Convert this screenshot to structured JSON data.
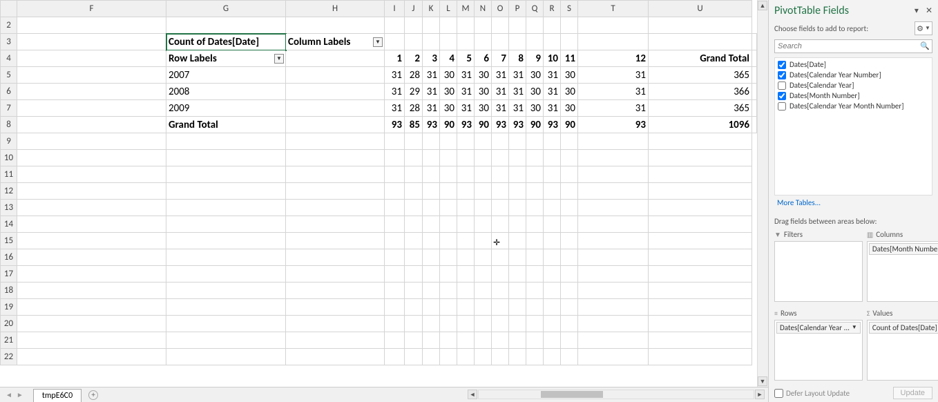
{
  "columns": [
    "F",
    "G",
    "H",
    "I",
    "J",
    "K",
    "L",
    "M",
    "N",
    "O",
    "P",
    "Q",
    "R",
    "S",
    "T",
    "U"
  ],
  "rows": [
    2,
    3,
    4,
    5,
    6,
    7,
    8,
    9,
    10,
    11,
    12,
    13,
    14,
    15,
    16,
    17,
    18,
    19,
    20,
    21,
    22
  ],
  "active_cell": "G3",
  "pivot": {
    "measure_label": "Count of Dates[Date]",
    "column_labels_label": "Column Labels",
    "row_labels_label": "Row Labels",
    "col_headers": [
      "1",
      "2",
      "3",
      "4",
      "5",
      "6",
      "7",
      "8",
      "9",
      "10",
      "11",
      "12"
    ],
    "grand_total_label": "Grand Total",
    "row_labels": [
      "2007",
      "2008",
      "2009"
    ],
    "data": [
      [
        "31",
        "28",
        "31",
        "30",
        "31",
        "30",
        "31",
        "31",
        "30",
        "31",
        "30",
        "31"
      ],
      [
        "31",
        "29",
        "31",
        "30",
        "31",
        "30",
        "31",
        "31",
        "30",
        "31",
        "30",
        "31"
      ],
      [
        "31",
        "28",
        "31",
        "30",
        "31",
        "30",
        "31",
        "31",
        "30",
        "31",
        "30",
        "31"
      ]
    ],
    "row_totals": [
      "365",
      "366",
      "365"
    ],
    "col_totals": [
      "93",
      "85",
      "93",
      "90",
      "93",
      "90",
      "93",
      "93",
      "90",
      "93",
      "90",
      "93"
    ],
    "grand_total_value": "1096"
  },
  "tabs": {
    "active": "tmpE6C0"
  },
  "pane": {
    "title": "PivotTable Fields",
    "subtitle": "Choose fields to add to report:",
    "search_placeholder": "Search",
    "fields": [
      {
        "label": "Dates[Date]",
        "checked": true
      },
      {
        "label": "Dates[Calendar Year Number]",
        "checked": true
      },
      {
        "label": "Dates[Calendar Year]",
        "checked": false
      },
      {
        "label": "Dates[Month Number]",
        "checked": true
      },
      {
        "label": "Dates[Calendar Year Month Number]",
        "checked": false
      }
    ],
    "more_tables": "More Tables...",
    "drag_hint": "Drag fields between areas below:",
    "areas": {
      "filters": {
        "label": "Filters",
        "items": []
      },
      "columns": {
        "label": "Columns",
        "items": [
          "Dates[Month Number]"
        ]
      },
      "rows": {
        "label": "Rows",
        "items": [
          "Dates[Calendar Year ..."
        ]
      },
      "values": {
        "label": "Values",
        "items": [
          "Count of Dates[Date]"
        ]
      }
    },
    "defer_label": "Defer Layout Update",
    "update_label": "Update"
  }
}
